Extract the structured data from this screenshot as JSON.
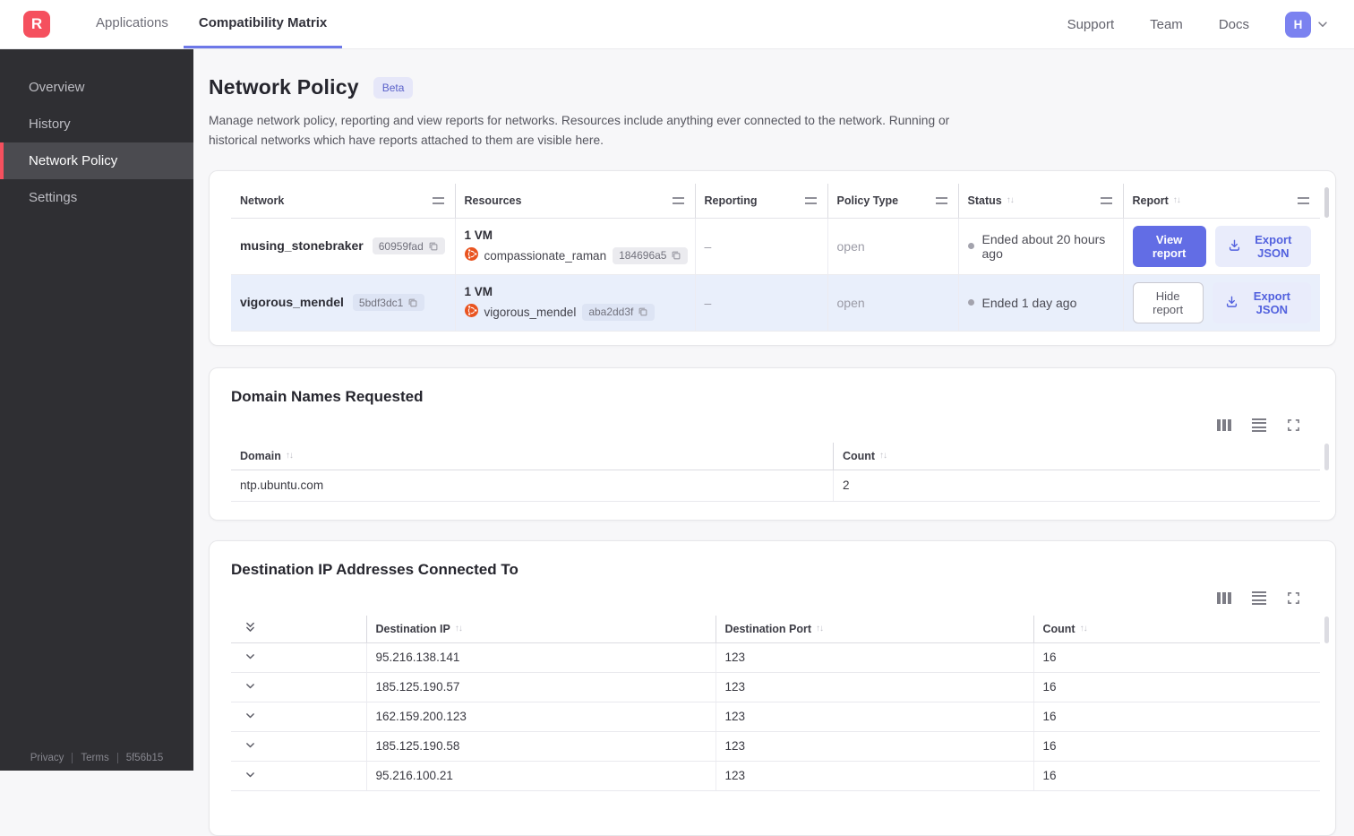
{
  "topnav": {
    "logo_letter": "R",
    "tabs": [
      {
        "label": "Applications"
      },
      {
        "label": "Compatibility Matrix"
      }
    ],
    "links": [
      {
        "label": "Support"
      },
      {
        "label": "Team"
      },
      {
        "label": "Docs"
      }
    ],
    "avatar_letter": "H"
  },
  "sidebar": {
    "items": [
      {
        "label": "Overview"
      },
      {
        "label": "History"
      },
      {
        "label": "Network Policy"
      },
      {
        "label": "Settings"
      }
    ],
    "footer": {
      "privacy": "Privacy",
      "terms": "Terms",
      "version": "5f56b15"
    }
  },
  "page": {
    "title": "Network Policy",
    "badge": "Beta",
    "description": "Manage network policy, reporting and view reports for networks. Resources include anything ever connected to the network. Running or historical networks which have reports attached to them are visible here."
  },
  "networks_table": {
    "headers": {
      "network": "Network",
      "resources": "Resources",
      "reporting": "Reporting",
      "policy_type": "Policy Type",
      "status": "Status",
      "report": "Report"
    },
    "rows": [
      {
        "network_name": "musing_stonebraker",
        "network_id": "60959fad",
        "resources_summary": "1 VM",
        "resource_name": "compassionate_raman",
        "resource_id": "184696a5",
        "reporting": "–",
        "policy_type": "open",
        "status": "Ended about 20 hours ago",
        "report_button": "View report",
        "export_button": "Export JSON"
      },
      {
        "network_name": "vigorous_mendel",
        "network_id": "5bdf3dc1",
        "resources_summary": "1 VM",
        "resource_name": "vigorous_mendel",
        "resource_id": "aba2dd3f",
        "reporting": "–",
        "policy_type": "open",
        "status": "Ended 1 day ago",
        "report_button": "Hide report",
        "export_button": "Export JSON"
      }
    ]
  },
  "domains_card": {
    "title": "Domain Names Requested",
    "headers": {
      "domain": "Domain",
      "count": "Count"
    },
    "rows": [
      {
        "domain": "ntp.ubuntu.com",
        "count": "2"
      }
    ]
  },
  "ips_card": {
    "title": "Destination IP Addresses Connected To",
    "headers": {
      "ip": "Destination IP",
      "port": "Destination Port",
      "count": "Count"
    },
    "rows": [
      {
        "ip": "95.216.138.141",
        "port": "123",
        "count": "16"
      },
      {
        "ip": "185.125.190.57",
        "port": "123",
        "count": "16"
      },
      {
        "ip": "162.159.200.123",
        "port": "123",
        "count": "16"
      },
      {
        "ip": "185.125.190.58",
        "port": "123",
        "count": "16"
      },
      {
        "ip": "95.216.100.21",
        "port": "123",
        "count": "16"
      }
    ]
  },
  "colors": {
    "accent_purple": "#626de5",
    "brand_red": "#f5505e",
    "ubuntu_orange": "#e95420",
    "selected_row": "#e9effb",
    "sidebar_bg": "#2f2f33"
  }
}
